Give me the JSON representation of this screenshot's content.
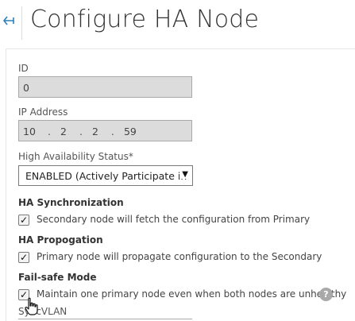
{
  "header": {
    "back_icon": "back-arrow-icon",
    "title": "Configure HA Node"
  },
  "form": {
    "id": {
      "label": "ID",
      "value": "0"
    },
    "ip_address": {
      "label": "IP Address",
      "octets": [
        "10",
        "2",
        "2",
        "59"
      ],
      "separator": "."
    },
    "ha_status": {
      "label": "High Availability Status*",
      "selected": "ENABLED (Actively Participate in"
    },
    "ha_sync": {
      "title": "HA Synchronization",
      "checkbox_label": "Secondary node will fetch the configuration from Primary",
      "checked": true
    },
    "ha_propagation": {
      "title": "HA Propogation",
      "checkbox_label": "Primary node will propagate configuration to the Secondary",
      "checked": true
    },
    "failsafe": {
      "title": "Fail-safe Mode",
      "checkbox_label": "Maintain one primary node even when both nodes are unhealthy",
      "checked": true,
      "help_icon": "question-mark-icon",
      "help_glyph": "?"
    },
    "sync_vlan": {
      "label": "SyncVLAN"
    }
  },
  "colors": {
    "accent": "#2c7fb8",
    "disabled_input_bg": "#dcdcdc",
    "help_icon_bg": "#a9a9a9"
  }
}
